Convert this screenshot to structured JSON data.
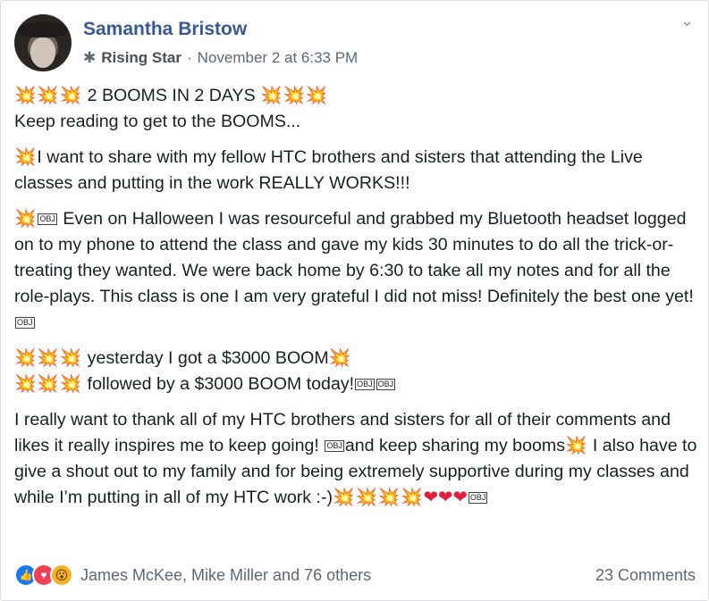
{
  "post": {
    "author": "Samantha Bristow",
    "badge_label": "Rising Star",
    "timestamp": "November 2 at 6:33 PM"
  },
  "icons": {
    "badge": "star-badge-icon",
    "menu": "chevron-down-icon"
  },
  "text": {
    "p1_title": " 2 BOOMS IN 2 DAYS ",
    "p1_line2": "Keep reading to get to the BOOMS...",
    "p2": "I want to share with my fellow HTC brothers and sisters that attending the Live classes and putting in the work REALLY WORKS!!!",
    "p3": " Even on Halloween I was resourceful and grabbed my Bluetooth headset logged on to my phone to attend the class and gave my kids 30 minutes to do all the trick-or-treating they wanted. We were back home by 6:30 to take all my notes and for all the role-plays. This class is one I am very grateful I did not miss! Definitely the best one yet!",
    "p4_line1": " yesterday I got a $3000 BOOM",
    "p4_line2": " followed by a $3000 BOOM today!",
    "p5_part1": "I really want to thank all of my HTC brothers and sisters for all of their comments and likes it really inspires me to keep going! ",
    "p5_part2": "and keep sharing my booms",
    "p5_part3": " I also have to give a shout out to my family and for being extremely supportive during my classes and while I’m putting in all of my HTC work :-)",
    "obj": "OBJ",
    "boom3": "💥💥💥",
    "boom1": "💥",
    "boom4": "💥💥💥💥",
    "hearts": "❤❤❤"
  },
  "footer": {
    "reactions_names": "James McKee, Mike Miller and 76 others",
    "comments": "23 Comments"
  },
  "colors": {
    "author": "#385898",
    "meta": "#606770",
    "like": "#1877f2",
    "love": "#f33e58",
    "wow": "#f7b125"
  }
}
